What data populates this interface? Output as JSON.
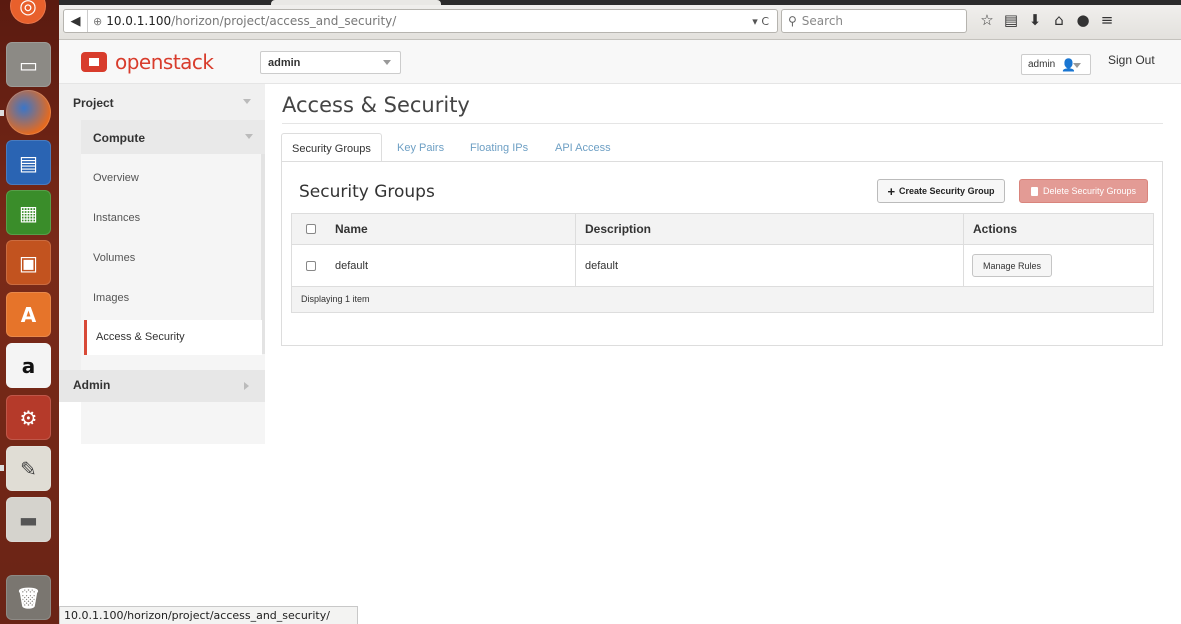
{
  "browser": {
    "url_host": "10.0.1.100",
    "url_path": "/horizon/project/access_and_security/",
    "search_placeholder": "Search",
    "status_url": "10.0.1.100/horizon/project/access_and_security/"
  },
  "launcher": {
    "apps": [
      "ubuntu-dash-icon",
      "files-icon",
      "firefox-icon",
      "writer-icon",
      "calc-icon",
      "impress-icon",
      "software-center-icon",
      "amazon-icon",
      "system-settings-icon",
      "text-editor-icon",
      "drive-icon",
      "trash-icon"
    ]
  },
  "header": {
    "logo_text": "openstack",
    "project_selector": "admin",
    "user_menu": "admin",
    "sign_out": "Sign Out"
  },
  "sidebar": {
    "project": "Project",
    "compute": "Compute",
    "items": [
      {
        "label": "Overview"
      },
      {
        "label": "Instances"
      },
      {
        "label": "Volumes"
      },
      {
        "label": "Images"
      },
      {
        "label": "Access & Security"
      }
    ],
    "admin": "Admin"
  },
  "main": {
    "title": "Access & Security",
    "tabs": [
      {
        "label": "Security Groups",
        "active": true
      },
      {
        "label": "Key Pairs"
      },
      {
        "label": "Floating IPs"
      },
      {
        "label": "API Access"
      }
    ],
    "panel_title": "Security Groups",
    "create_button": "Create Security Group",
    "delete_button": "Delete Security Groups",
    "table": {
      "columns": [
        "Name",
        "Description",
        "Actions"
      ],
      "rows": [
        {
          "name": "default",
          "description": "default",
          "action": "Manage Rules"
        }
      ],
      "footer": "Displaying 1 item"
    }
  },
  "colors": {
    "brand": "#d83c2c",
    "tab_link": "#6d9fc4",
    "delete_button": "#e39b95"
  }
}
